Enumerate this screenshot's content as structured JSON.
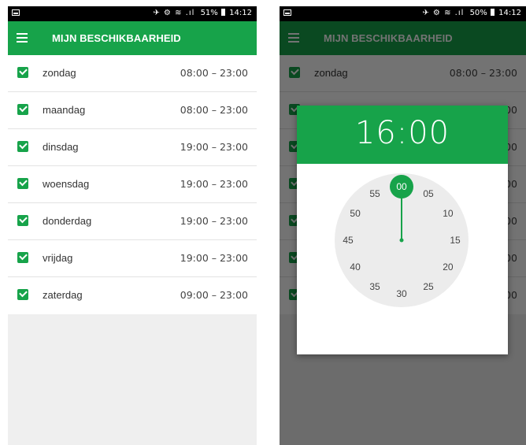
{
  "status_left": {
    "icons": "✈ ⚙ ≋ .ıl",
    "battery": "51%",
    "time": "14:12"
  },
  "status_right": {
    "icons": "✈ ⚙ ≋ .ıl",
    "battery": "50%",
    "time": "14:12"
  },
  "appbar": {
    "title": "MIJN BESCHIKBAARHEID"
  },
  "days": [
    {
      "name": "zondag",
      "time": "08:00 – 23:00"
    },
    {
      "name": "maandag",
      "time": "08:00 – 23:00"
    },
    {
      "name": "dinsdag",
      "time": "19:00 – 23:00"
    },
    {
      "name": "woensdag",
      "time": "19:00 – 23:00"
    },
    {
      "name": "donderdag",
      "time": "19:00 – 23:00"
    },
    {
      "name": "vrijdag",
      "time": "19:00 – 23:00"
    },
    {
      "name": "zaterdag",
      "time": "09:00 – 23:00"
    }
  ],
  "picker": {
    "selected_time": "16:00",
    "minutes": [
      "00",
      "05",
      "10",
      "15",
      "20",
      "25",
      "30",
      "35",
      "40",
      "45",
      "50",
      "55"
    ],
    "selected_minute": "00"
  },
  "colors": {
    "accent": "#17a34a"
  }
}
